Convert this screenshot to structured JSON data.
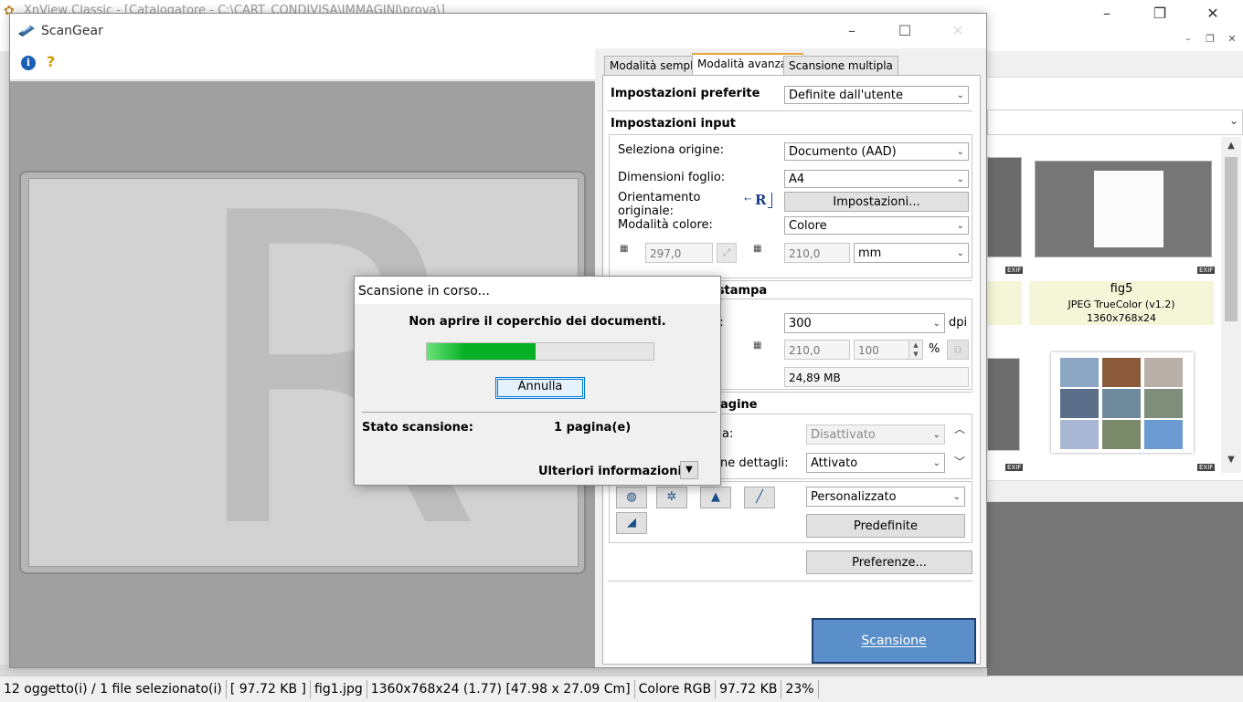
{
  "background_app": {
    "title": "XnView Classic - [Catalogatore - C:\\CART_CONDIVISA\\IMMAGINI\\prova\\]",
    "thumb_badge": "EXIF",
    "selected_thumb": {
      "name": "fig5",
      "type": "JPEG TrueColor (v1.2)",
      "size": "1360x768x24"
    }
  },
  "statusbar": {
    "objects": "12 oggetto(i) / 1 file selezionato(i)",
    "size": "[ 97.72 KB ]",
    "filename": "fig1.jpg",
    "dimensions": "1360x768x24 (1.77) [47.98 x 27.09 Cm]",
    "color": "Colore RGB",
    "filesize": "97.72 KB",
    "zoom": "23%"
  },
  "scangear": {
    "title": "ScanGear",
    "tabs": [
      "Modalità semplice",
      "Modalità avanzata",
      "Scansione multipla"
    ],
    "favorite_settings": {
      "label": "Impostazioni preferite",
      "value": "Definite dall'utente"
    },
    "input_settings": {
      "header": "Impostazioni input",
      "source_label": "Seleziona origine:",
      "source_value": "Documento (AAD)",
      "paper_label": "Dimensioni foglio:",
      "paper_value": "A4",
      "orientation_label_1": "Orientamento",
      "orientation_label_2": "originale:",
      "settings_button": "Impostazioni...",
      "color_mode_label": "Modalità colore:",
      "color_mode_value": "Colore",
      "height_value": "297,0",
      "width_value": "210,0",
      "unit_value": "mm"
    },
    "output_settings": {
      "header": "Impostazioni di stampa",
      "resolution_label_tail": "ut:",
      "resolution_value": "300",
      "resolution_unit": "dpi",
      "output_width": "210,0",
      "scale_value": "100",
      "scale_unit": "%",
      "data_size": "24,89 MB"
    },
    "image_settings": {
      "header_tail": "agine",
      "row1_label_tail": "a:",
      "row1_value": "Disattivato",
      "row2_label_tail": "ne dettagli:",
      "row2_value": "Attivato"
    },
    "tone_preset": "Personalizzato",
    "defaults_button": "Predefinite",
    "preferences_button": "Preferenze...",
    "scan_button": "Scansione",
    "preview_letter": "R"
  },
  "dialog": {
    "title": "Scansione in corso...",
    "message": "Non aprire il coperchio dei documenti.",
    "progress": 0.48,
    "cancel_button": "Annulla",
    "status_label": "Stato scansione:",
    "status_value": "1 pagina(e)",
    "more_info": "Ulteriori informazioni"
  },
  "colors": {
    "scan_button_bg": "#5b8fc9",
    "progress_fill": "#06b025",
    "active_tab_accent": "#e8a33a"
  }
}
